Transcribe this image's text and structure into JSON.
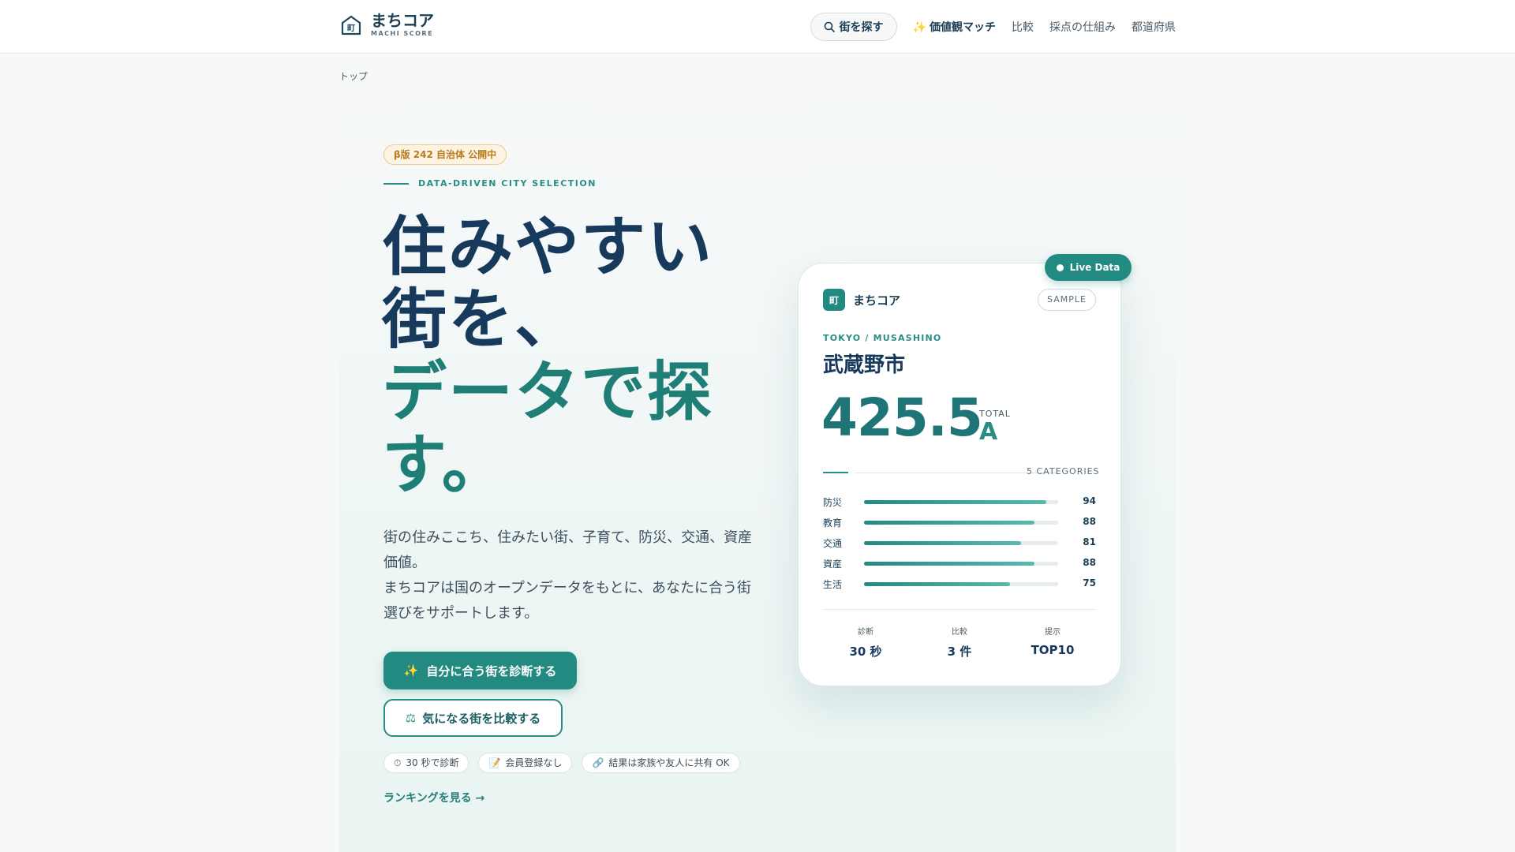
{
  "header": {
    "logo_title": "まちコア",
    "logo_sub": "MACHI SCORE",
    "logo_mark_text": "町",
    "nav": {
      "search_label": "街を探す",
      "value_match_label": "価値観マッチ",
      "compare_label": "比較",
      "scoring_label": "採点の仕組み",
      "prefectures_label": "都道府県"
    }
  },
  "breadcrumb": "トップ",
  "hero": {
    "beta_badge": "β版 242 自治体 公開中",
    "eyebrow": "DATA-DRIVEN CITY SELECTION",
    "headline_line1": "住みやすい",
    "headline_line2": "街を、",
    "headline_line3": "データで探",
    "headline_line4": "す。",
    "description_line1": "街の住みここち、住みたい街、子育て、防災、交通、資産価値。",
    "description_line2": "まちコアは国のオープンデータをもとに、あなたに合う街選びをサポートします。",
    "primary_button": "自分に合う街を診断する",
    "secondary_button": "気になる街を比較する",
    "chips": [
      "30 秒で診断",
      "会員登録なし",
      "結果は家族や友人に共有 OK"
    ],
    "ranking_link": "ランキングを見る →"
  },
  "card": {
    "live_badge": "Live Data",
    "logo_mark": "町",
    "logo_name": "まちコア",
    "sample_badge": "SAMPLE",
    "region": "TOKYO / MUSASHINO",
    "city": "武蔵野市",
    "score": "425.5",
    "total_label": "TOTAL",
    "grade": "A",
    "categories_label": "5 CATEGORIES",
    "categories": [
      {
        "name": "防災",
        "value": "94",
        "pct": 94
      },
      {
        "name": "教育",
        "value": "88",
        "pct": 88
      },
      {
        "name": "交通",
        "value": "81",
        "pct": 81
      },
      {
        "name": "資産",
        "value": "88",
        "pct": 88
      },
      {
        "name": "生活",
        "value": "75",
        "pct": 75
      }
    ],
    "stats": [
      {
        "label": "診断",
        "value": "30 秒"
      },
      {
        "label": "比較",
        "value": "3 件"
      },
      {
        "label": "提示",
        "value": "TOP10"
      }
    ]
  },
  "colors": {
    "accent": "#228a81",
    "heading": "#173a5c",
    "badge_amber": "#b87b1c"
  },
  "icons": {
    "logo": "house-icon",
    "search": "search-icon",
    "sparkle": "sparkle-icon",
    "scale": "scale-icon",
    "timer": "timer-icon",
    "memo": "memo-icon",
    "link": "link-icon"
  }
}
